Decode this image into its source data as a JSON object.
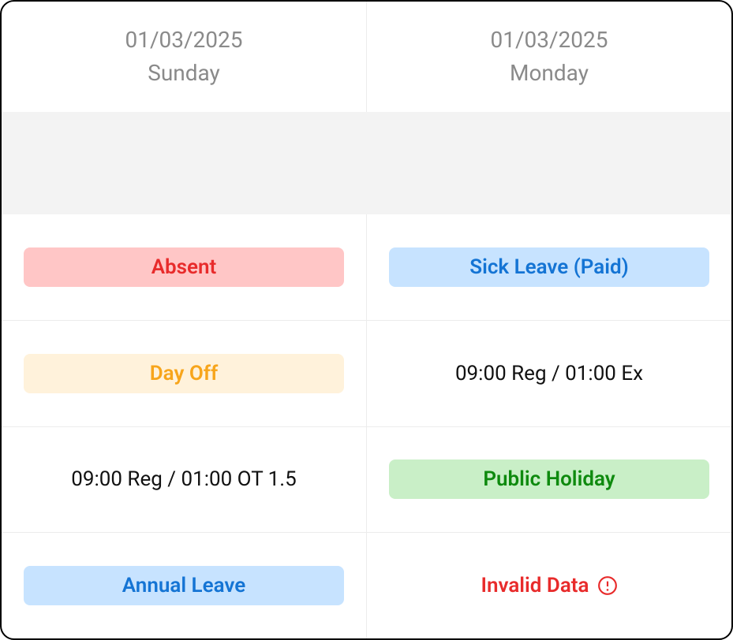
{
  "header": {
    "columns": [
      {
        "date": "01/03/2025",
        "day": "Sunday"
      },
      {
        "date": "01/03/2025",
        "day": "Monday"
      }
    ]
  },
  "rows": [
    {
      "left": {
        "type": "badge",
        "label": "Absent",
        "style": "absent"
      },
      "right": {
        "type": "badge",
        "label": "Sick Leave (Paid)",
        "style": "sick"
      }
    },
    {
      "left": {
        "type": "badge",
        "label": "Day Off",
        "style": "dayoff"
      },
      "right": {
        "type": "text",
        "label": "09:00 Reg / 01:00 Ex"
      }
    },
    {
      "left": {
        "type": "text",
        "label": "09:00 Reg / 01:00 OT 1.5"
      },
      "right": {
        "type": "badge",
        "label": "Public Holiday",
        "style": "holiday"
      }
    },
    {
      "left": {
        "type": "badge",
        "label": "Annual Leave",
        "style": "annual"
      },
      "right": {
        "type": "invalid",
        "label": "Invalid Data"
      }
    }
  ]
}
